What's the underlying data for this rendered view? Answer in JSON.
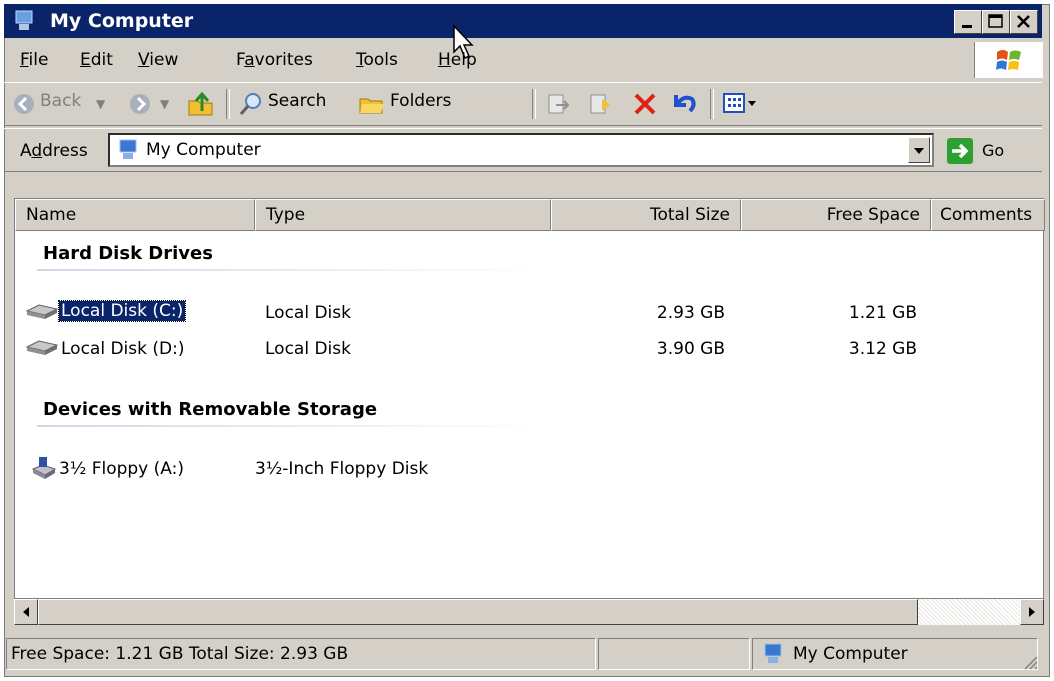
{
  "window": {
    "title": "My Computer"
  },
  "menu": {
    "items": [
      {
        "label": "File",
        "key": "F",
        "rest": "ile"
      },
      {
        "label": "Edit",
        "key": "E",
        "rest": "dit"
      },
      {
        "label": "View",
        "key": "V",
        "rest": "iew"
      },
      {
        "label": "Favorites",
        "pre": "F",
        "key": "a",
        "rest": "vorites"
      },
      {
        "label": "Tools",
        "key": "T",
        "rest": "ools"
      },
      {
        "label": "Help",
        "key": "H",
        "rest": "elp"
      }
    ]
  },
  "toolbar": {
    "back_label": "Back",
    "search_label": "Search",
    "folders_label": "Folders"
  },
  "address": {
    "label": "Address",
    "label_pre": "A",
    "label_key": "d",
    "label_rest": "dress",
    "value": "My Computer",
    "go_label": "Go"
  },
  "columns": {
    "name": "Name",
    "type": "Type",
    "total_size": "Total Size",
    "free_space": "Free Space",
    "comments": "Comments"
  },
  "groups": [
    {
      "title": "Hard Disk Drives",
      "items": [
        {
          "name": "Local Disk (C:)",
          "type": "Local Disk",
          "total": "2.93 GB",
          "free": "1.21 GB"
        },
        {
          "name": "Local Disk (D:)",
          "type": "Local Disk",
          "total": "3.90 GB",
          "free": "3.12 GB"
        }
      ]
    },
    {
      "title": "Devices with Removable Storage",
      "items": [
        {
          "name": "3½ Floppy (A:)",
          "type": "3½-Inch Floppy Disk",
          "total": "",
          "free": ""
        }
      ]
    }
  ],
  "status": {
    "info": "Free Space: 1.21 GB Total Size: 2.93 GB",
    "zone": "My Computer"
  },
  "colors": {
    "titlebar": "#0a246a",
    "chrome": "#d4d0c8",
    "selection": "#0a246a"
  }
}
